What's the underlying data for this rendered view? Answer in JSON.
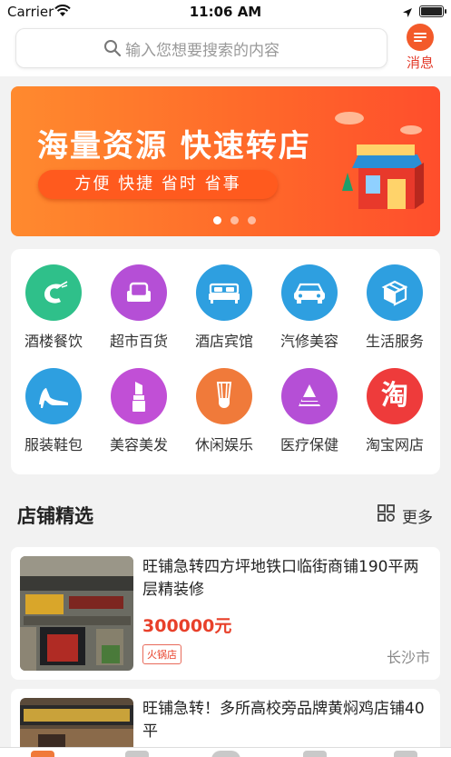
{
  "status_bar": {
    "carrier": "Carrier",
    "time": "11:06 AM"
  },
  "search": {
    "placeholder": "输入您想要搜索的内容"
  },
  "message": {
    "label": "消息"
  },
  "banner": {
    "title": "海量资源 快速转店",
    "subtitle": "方便 快捷 省时 省事",
    "dots": 3,
    "active_dot": 1
  },
  "categories": [
    {
      "label": "酒楼餐饮",
      "icon": "shrimp-icon",
      "color": "#2fc08a"
    },
    {
      "label": "超市百货",
      "icon": "sofa-icon",
      "color": "#b54fd6"
    },
    {
      "label": "酒店宾馆",
      "icon": "bed-icon",
      "color": "#2e9fe0"
    },
    {
      "label": "汽修美容",
      "icon": "car-icon",
      "color": "#2e9fe0"
    },
    {
      "label": "生活服务",
      "icon": "box-icon",
      "color": "#2e9fe0"
    },
    {
      "label": "服装鞋包",
      "icon": "high-heel-icon",
      "color": "#2e9fe0"
    },
    {
      "label": "美容美发",
      "icon": "lipstick-icon",
      "color": "#c14fd6"
    },
    {
      "label": "休闲娱乐",
      "icon": "shuttlecock-icon",
      "color": "#f07a3a"
    },
    {
      "label": "医疗保健",
      "icon": "pill-icon",
      "color": "#b54fd6"
    },
    {
      "label": "淘宝网店",
      "icon": "taobao-icon",
      "color": "#ee3b3b"
    }
  ],
  "section": {
    "title": "店铺精选",
    "more_label": "更多"
  },
  "listings": [
    {
      "title": "旺铺急转四方坪地铁口临街商铺190平两层精装修",
      "price": "300000元",
      "tag": "火锅店",
      "city": "长沙市"
    },
    {
      "title": "旺铺急转！多所高校旁品牌黄焖鸡店铺40平"
    }
  ]
}
